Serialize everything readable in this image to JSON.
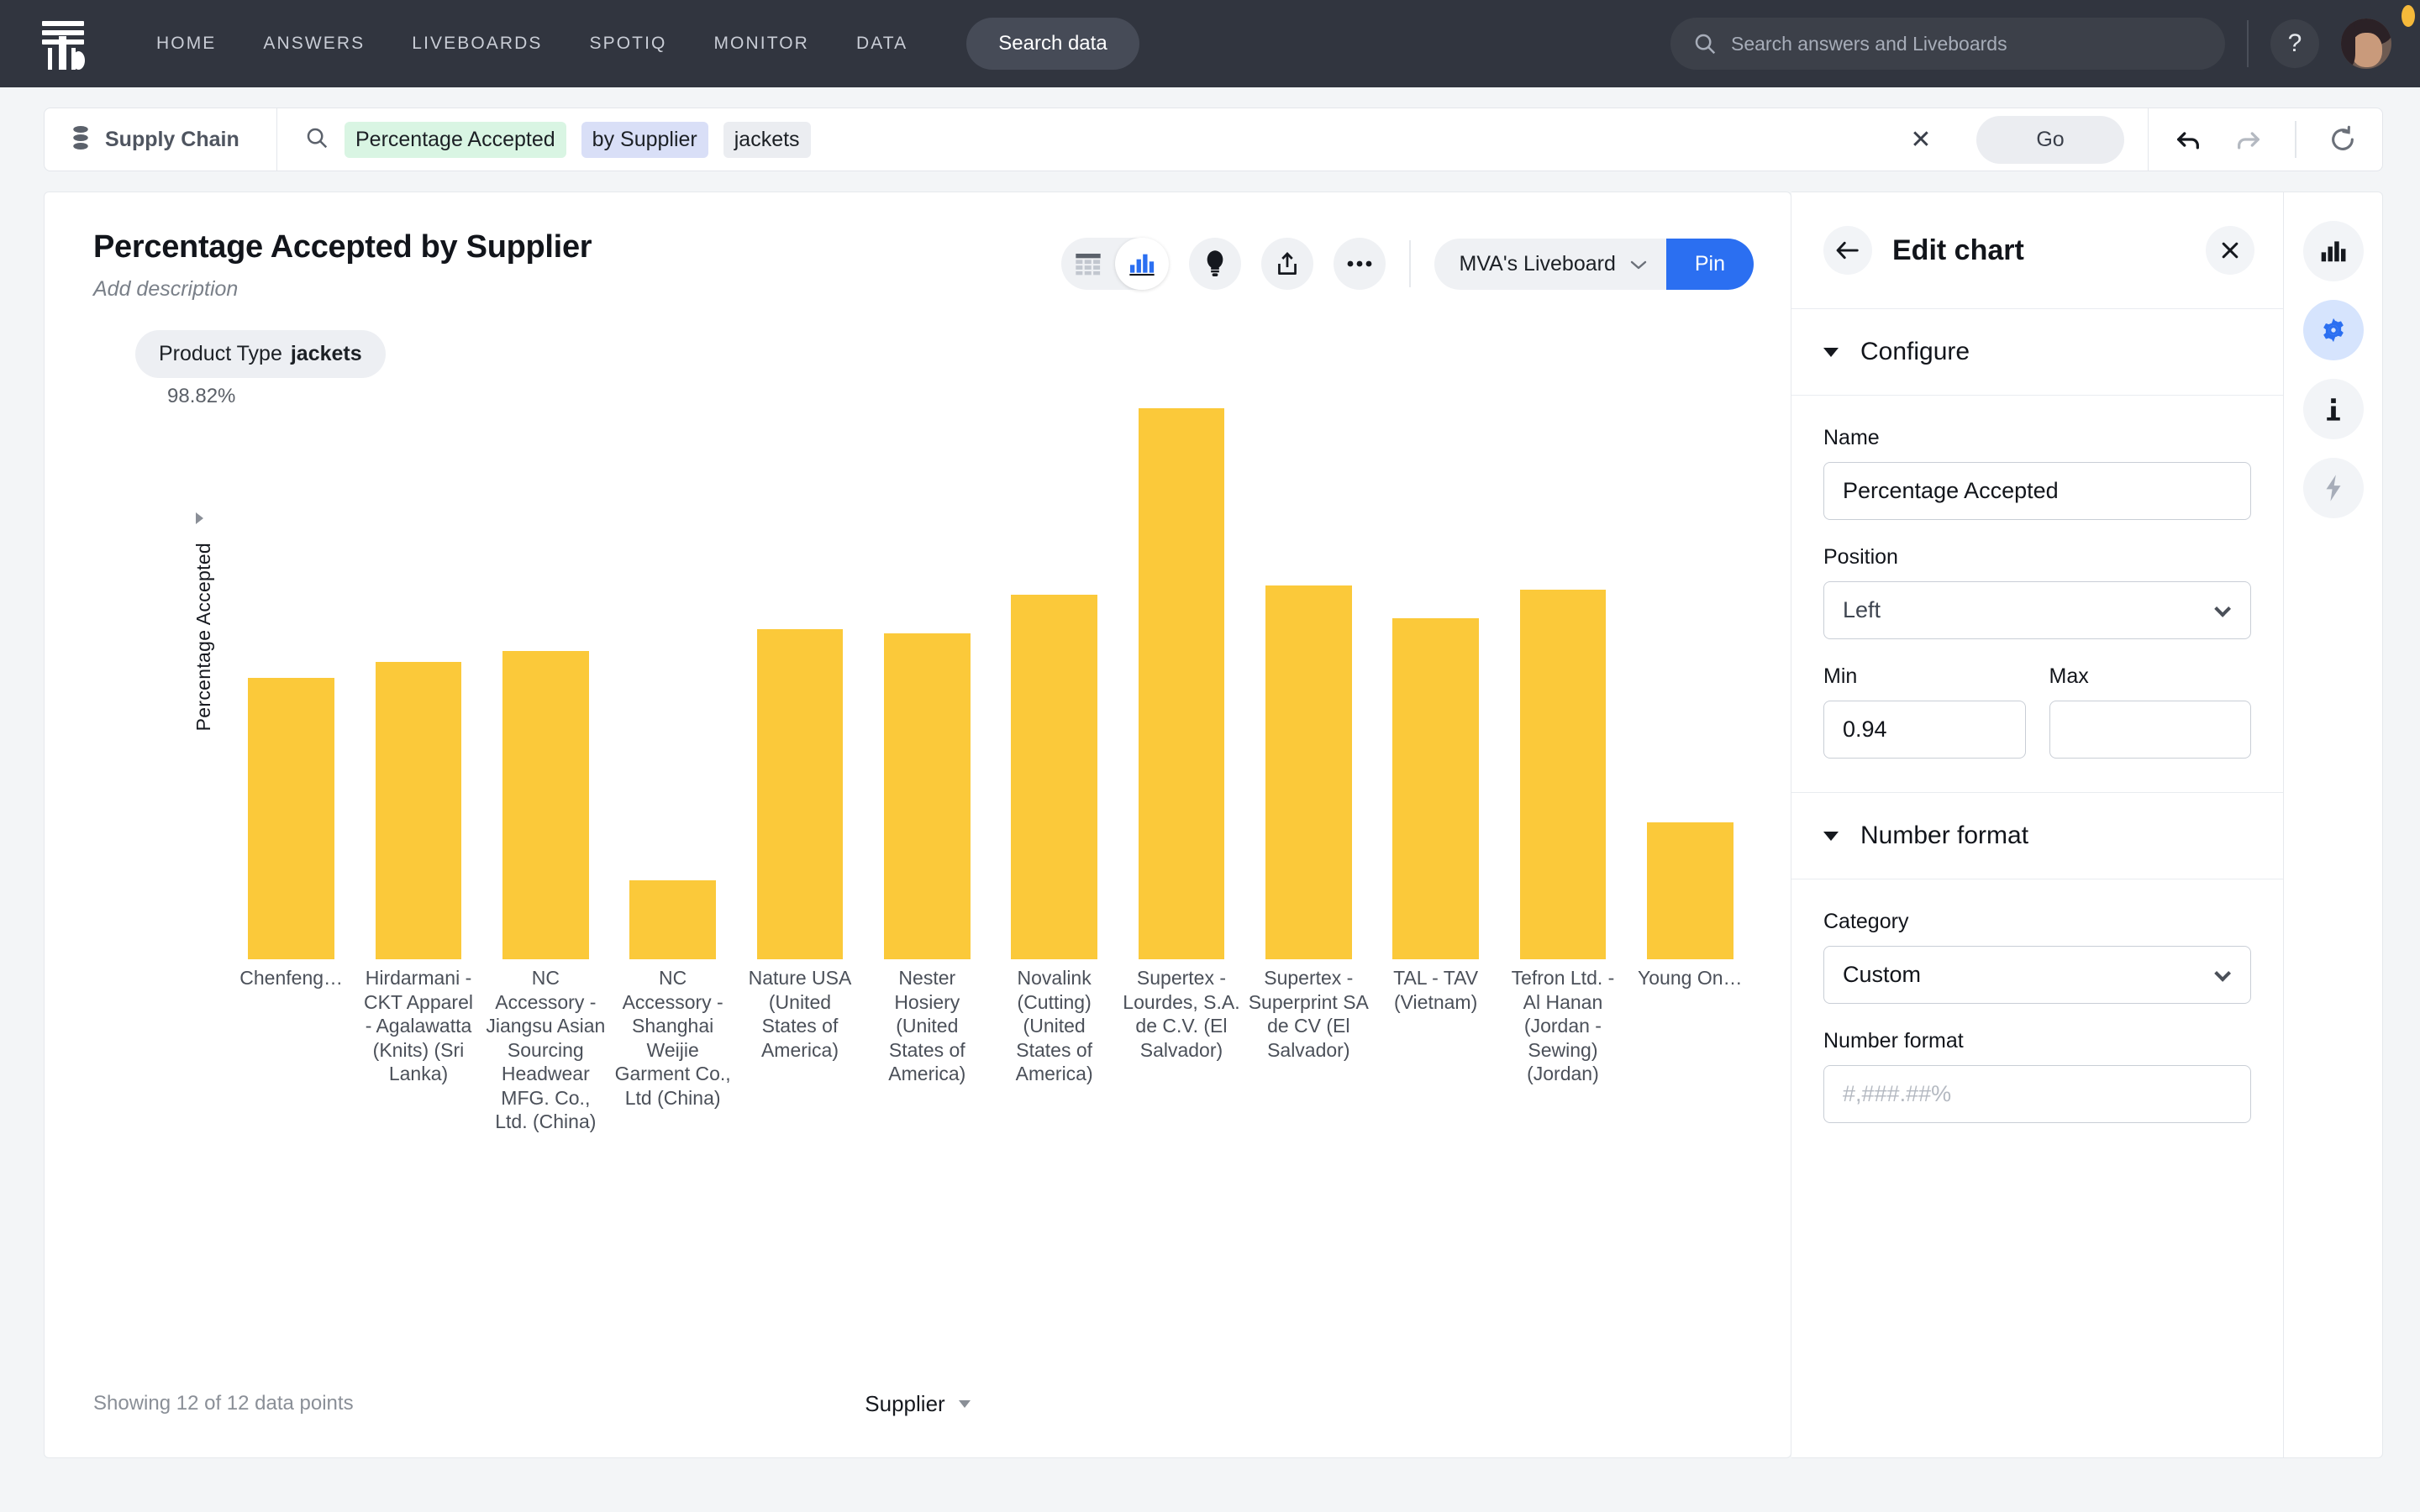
{
  "topnav": {
    "logo": "thoughtspot-logo",
    "items": [
      "HOME",
      "ANSWERS",
      "LIVEBOARDS",
      "SPOTIQ",
      "MONITOR",
      "DATA"
    ],
    "search_data_label": "Search data",
    "global_search_placeholder": "Search answers and Liveboards",
    "help_label": "?",
    "background": "#31353F"
  },
  "querybar": {
    "source": "Supply Chain",
    "tokens": [
      {
        "text": "Percentage Accepted",
        "kind": "measure"
      },
      {
        "text": "by Supplier",
        "kind": "attribute"
      },
      {
        "text": "jackets",
        "kind": "filter"
      }
    ],
    "clear_label": "✕",
    "go_label": "Go",
    "undo_icon": "undo-arrow-icon",
    "redo_icon": "redo-arrow-icon",
    "reset_icon": "reset-circular-arrow-icon"
  },
  "answer": {
    "title": "Percentage Accepted by Supplier",
    "description": "Add description",
    "liveboard": "MVA's Liveboard",
    "pin_label": "Pin",
    "filter_chip_label": "Product Type",
    "filter_chip_value": "jackets",
    "datapoints": "Showing 12 of 12 data points",
    "xaxis_title": "Supplier",
    "accent_blue": "#2B6FF1",
    "bar_color": "#FBC93A"
  },
  "chart_data": {
    "type": "bar",
    "title": "Percentage Accepted by Supplier",
    "xlabel": "Supplier",
    "ylabel": "Percentage Accepted",
    "ylim": [
      0.94,
      0.9882
    ],
    "ymax_label": "98.82%",
    "grid": false,
    "legend": "none",
    "categories": [
      "Chenfeng…",
      "Hirdarmani - CKT Apparel - Agalawatta (Knits) (Sri Lanka)",
      "NC Accessory - Jiangsu Asian Sourcing Headwear MFG. Co., Ltd. (China)",
      "NC Accessory - Shanghai Weijie Garment Co., Ltd (China)",
      "Nature USA (United States of America)",
      "Nester Hosiery (United States of America)",
      "Novalink (Cutting) (United States of America)",
      "Supertex - Lourdes, S.A. de C.V. (El Salvador)",
      "Supertex - Superprint SA de CV (El Salvador)",
      "TAL - TAV (Vietnam)",
      "Tefron Ltd. - Al Hanan (Jordan - Sewing) (Jordan)",
      "Young On…"
    ],
    "values": [
      96.46,
      96.6,
      96.7,
      94.69,
      96.89,
      96.85,
      97.19,
      98.82,
      97.27,
      96.98,
      97.23,
      95.2
    ],
    "value_unit": "%"
  },
  "edit_panel": {
    "title": "Edit chart",
    "back_icon": "back-arrow-icon",
    "close_icon": "close-icon",
    "configure_section": "Configure",
    "name_label": "Name",
    "name_value": "Percentage Accepted",
    "position_label": "Position",
    "position_value": "Left",
    "min_label": "Min",
    "min_value": "0.94",
    "max_label": "Max",
    "max_value": "",
    "number_format_section": "Number format",
    "category_label": "Category",
    "category_value": "Custom",
    "number_format_label": "Number format",
    "number_format_placeholder": "#,###.##%"
  },
  "right_rail": {
    "items": [
      {
        "icon": "chart-bars-icon",
        "active": false
      },
      {
        "icon": "gear-icon",
        "active": true
      },
      {
        "icon": "info-icon",
        "active": false
      },
      {
        "icon": "lightning-bolt-icon",
        "active": false
      }
    ]
  }
}
